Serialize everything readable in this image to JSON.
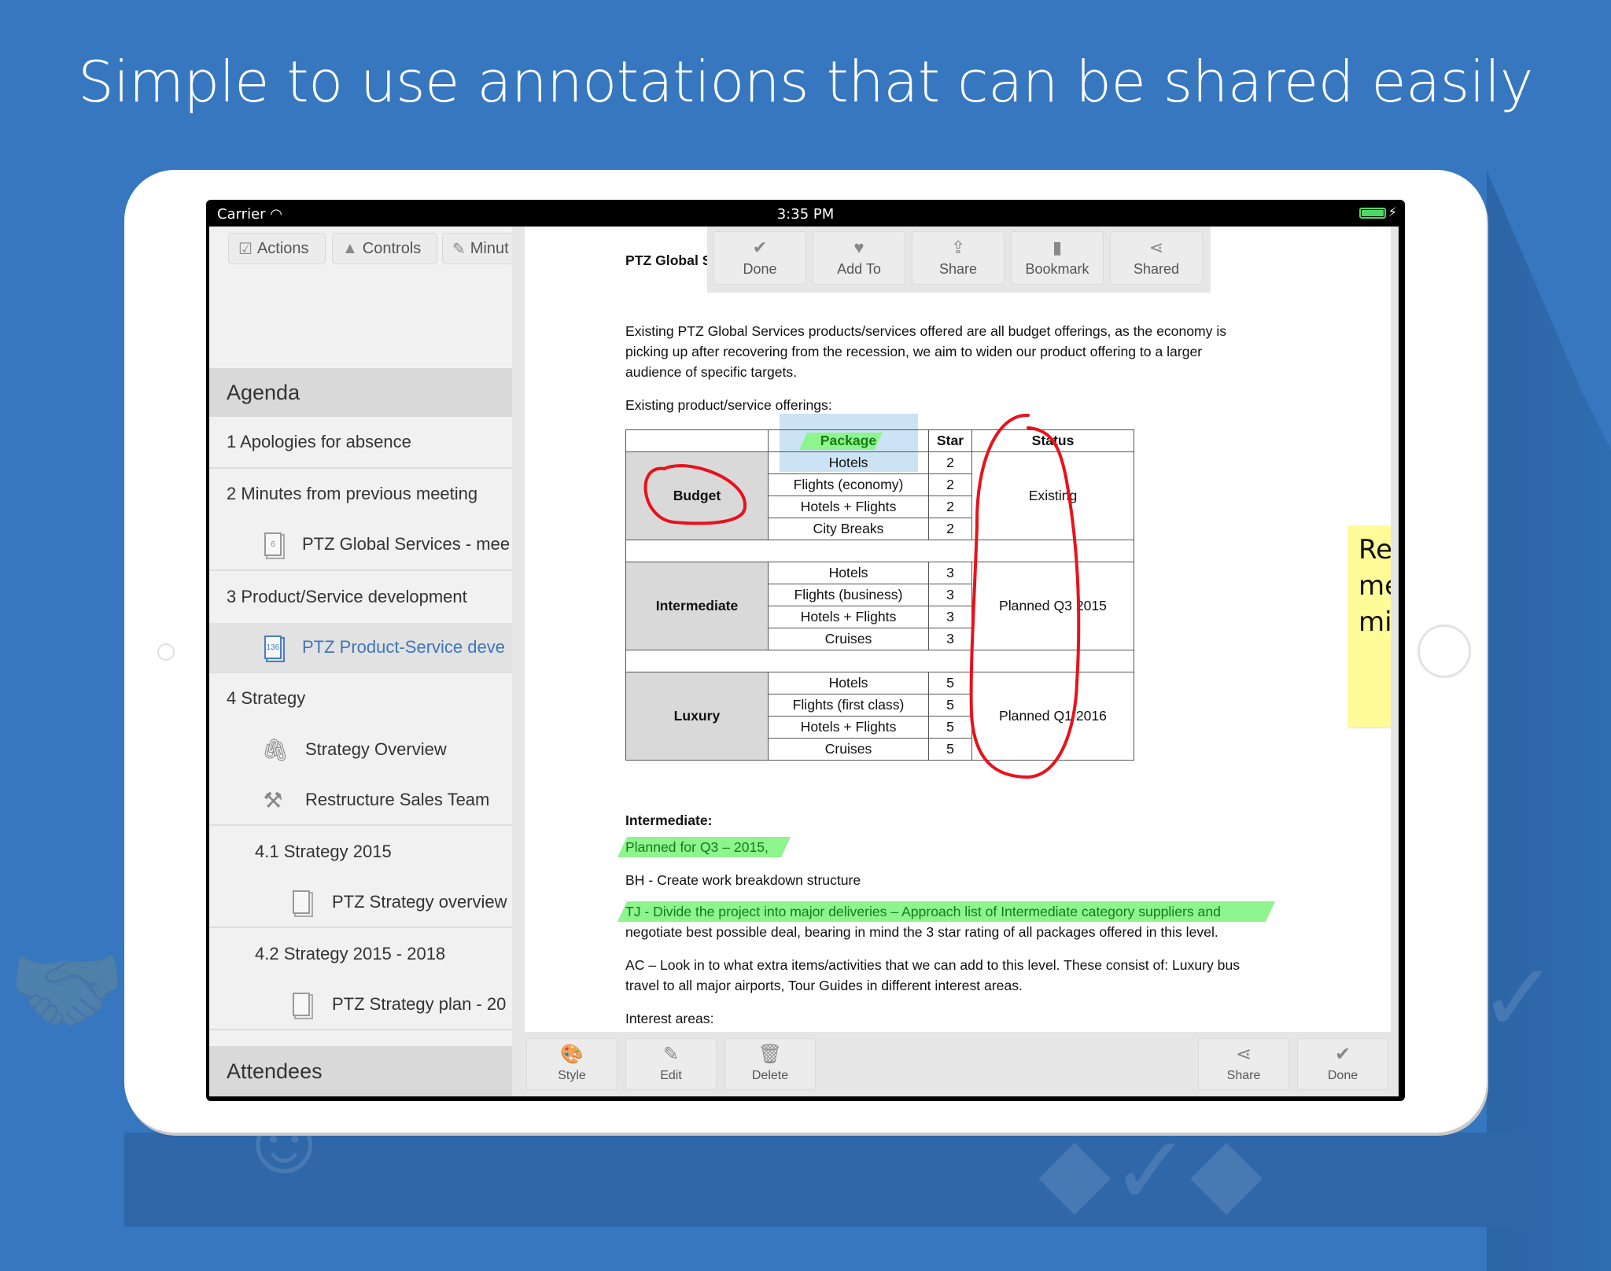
{
  "headline": "Simple to use annotations that can be shared easily",
  "status_bar": {
    "carrier": "Carrier",
    "time": "3:35 PM",
    "battery_percent": 100,
    "charging": true
  },
  "sidebar": {
    "segments": [
      {
        "label": "Actions",
        "icon": "actions-icon"
      },
      {
        "label": "Controls",
        "icon": "controls-icon"
      },
      {
        "label": "Minut",
        "icon": "minutes-icon"
      }
    ],
    "agenda_header": "Agenda",
    "items": [
      {
        "label": "1 Apologies for absence",
        "level": 0
      },
      {
        "label": "2 Minutes from previous meeting",
        "level": 0
      },
      {
        "label": "PTZ Global Services - mee",
        "level": 1,
        "icon": "document-icon",
        "badge": "6"
      },
      {
        "label": "3 Product/Service development",
        "level": 0
      },
      {
        "label": "PTZ Product-Service deve",
        "level": 1,
        "icon": "document-icon",
        "badge": "136",
        "active": true
      },
      {
        "label": "4 Strategy",
        "level": 0
      },
      {
        "label": "Strategy Overview",
        "level": 1,
        "icon": "paperclip-icon"
      },
      {
        "label": "Restructure Sales Team",
        "level": 1,
        "icon": "gavel-icon"
      },
      {
        "label": "4.1 Strategy 2015",
        "level": 1
      },
      {
        "label": "PTZ Strategy overview",
        "level": 2,
        "icon": "document-icon"
      },
      {
        "label": "4.2 Strategy 2015 - 2018",
        "level": 1
      },
      {
        "label": "PTZ Strategy plan - 20",
        "level": 2,
        "icon": "document-icon"
      }
    ],
    "attendees_header": "Attendees"
  },
  "top_toolbar": [
    {
      "label": "Done",
      "icon": "checkmark-icon"
    },
    {
      "label": "Add To",
      "icon": "handshake-icon"
    },
    {
      "label": "Share",
      "icon": "share-upload-icon"
    },
    {
      "label": "Bookmark",
      "icon": "bookmark-icon"
    },
    {
      "label": "Shared",
      "icon": "share-nodes-icon"
    }
  ],
  "document": {
    "title_partial": "PTZ Global S",
    "intro_lines": [
      "Existing PTZ Global Services products/services offered are all budget offerings, as the economy is",
      "picking up after recovering from the recession, we aim to widen our product offering to a larger",
      "audience of specific targets."
    ],
    "offerings_label": "Existing product/service offerings:",
    "table": {
      "headers": [
        "",
        "Package",
        "Star",
        "Status"
      ],
      "groups": [
        {
          "category": "Budget",
          "status": "Existing",
          "rows": [
            {
              "package": "Hotels",
              "star": "2"
            },
            {
              "package": "Flights (economy)",
              "star": "2"
            },
            {
              "package": "Hotels + Flights",
              "star": "2"
            },
            {
              "package": "City Breaks",
              "star": "2"
            }
          ]
        },
        {
          "category": "Intermediate",
          "status": "Planned Q3 2015",
          "rows": [
            {
              "package": "Hotels",
              "star": "3"
            },
            {
              "package": "Flights (business)",
              "star": "3"
            },
            {
              "package": "Hotels + Flights",
              "star": "3"
            },
            {
              "package": "Cruises",
              "star": "3"
            }
          ]
        },
        {
          "category": "Luxury",
          "status": "Planned Q1 2016",
          "rows": [
            {
              "package": "Hotels",
              "star": "5"
            },
            {
              "package": "Flights (first class)",
              "star": "5"
            },
            {
              "package": "Hotels + Flights",
              "star": "5"
            },
            {
              "package": "Cruises",
              "star": "5"
            }
          ]
        }
      ]
    },
    "sticky_note": "Review meeting minutes",
    "section_heading": "Intermediate:",
    "highlight_1": "Planned for Q3 – 2015,",
    "line_bh": "BH - Create work breakdown structure",
    "highlight_2": "TJ - Divide the project into major deliveries – Approach list of Intermediate category suppliers and",
    "line_tj_cont": "negotiate best possible deal, bearing in mind the 3 star rating of all packages offered in this level.",
    "line_ac_1": "AC – Look in to what extra items/activities that we can add to this level. These consist of: Luxury bus",
    "line_ac_2": "travel to all major airports, Tour Guides in different interest areas.",
    "interest_areas": "Interest areas:"
  },
  "bottom_toolbar": {
    "left": [
      {
        "label": "Style",
        "icon": "palette-icon"
      },
      {
        "label": "Edit",
        "icon": "edit-icon"
      },
      {
        "label": "Delete",
        "icon": "trash-icon"
      }
    ],
    "right": [
      {
        "label": "Share",
        "icon": "share-nodes-icon"
      },
      {
        "label": "Done",
        "icon": "checkmark-icon"
      }
    ]
  },
  "colors": {
    "background": "#3677c0",
    "highlight_green": "#8ef48e",
    "ink_red": "#e8121b",
    "sticky_yellow": "#fffb98",
    "selection_blue": "#cce3f5",
    "active_blue": "#3c76bd"
  }
}
